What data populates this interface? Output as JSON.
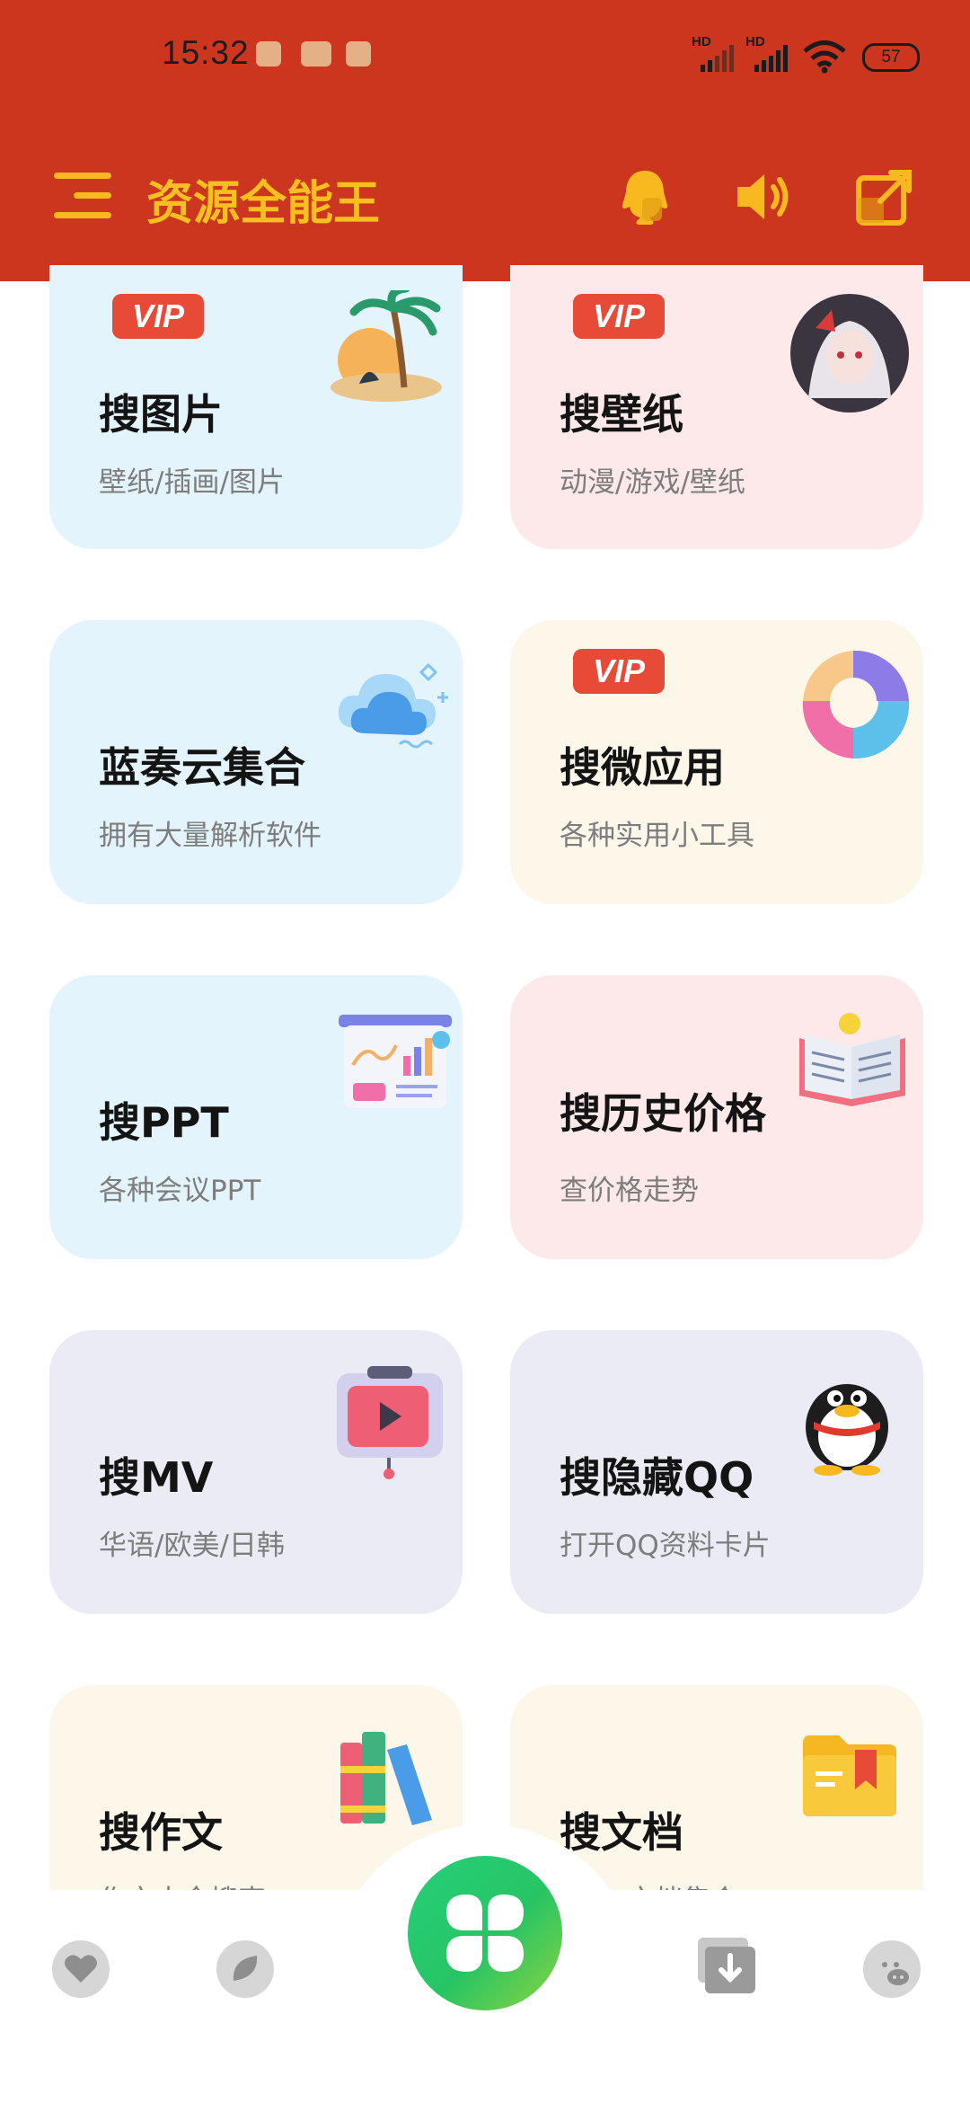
{
  "status_bar": {
    "time": "15:32",
    "signal_labels": [
      "HD",
      "HD"
    ],
    "battery": "57"
  },
  "app_bar": {
    "title": "资源全能王",
    "accent_color": "#f7c01f",
    "background_color": "#cd361e"
  },
  "cards": [
    {
      "title": "搜图片",
      "subtitle": "壁纸/插画/图片",
      "vip": "VIP",
      "icon": "island-icon",
      "bg": "#e4f4fc"
    },
    {
      "title": "搜壁纸",
      "subtitle": "动漫/游戏/壁纸",
      "vip": "VIP",
      "icon": "anime-avatar-icon",
      "bg": "#fde9e9"
    },
    {
      "title": "蓝奏云集合",
      "subtitle": "拥有大量解析软件",
      "vip": "",
      "icon": "cloud-icon",
      "bg": "#e4f4fc"
    },
    {
      "title": "搜微应用",
      "subtitle": "各种实用小工具",
      "vip": "VIP",
      "icon": "donut-chart-icon",
      "bg": "#fdf7ea"
    },
    {
      "title": "搜PPT",
      "subtitle": "各种会议PPT",
      "vip": "",
      "icon": "presentation-board-icon",
      "bg": "#e4f4fc"
    },
    {
      "title": "搜历史价格",
      "subtitle": "查价格走势",
      "vip": "",
      "icon": "open-book-bulb-icon",
      "bg": "#fde9e9"
    },
    {
      "title": "搜MV",
      "subtitle": "华语/欧美/日韩",
      "vip": "",
      "icon": "video-player-icon",
      "bg": "#ebebf5"
    },
    {
      "title": "搜隐藏QQ",
      "subtitle": "打开QQ资料卡片",
      "vip": "",
      "icon": "qq-penguin-icon",
      "bg": "#ebebf5"
    },
    {
      "title": "搜作文",
      "subtitle": "作文大全搜索",
      "vip": "",
      "icon": "books-icon",
      "bg": "#fdf7ea"
    },
    {
      "title": "搜文档",
      "subtitle": "文档集合",
      "vip": "",
      "icon": "folder-icon",
      "bg": "#fdf7ea"
    }
  ],
  "bottom_nav": {
    "items": [
      "heart-icon",
      "leaf-icon",
      "clover-icon",
      "download-icon",
      "pig-icon"
    ]
  }
}
